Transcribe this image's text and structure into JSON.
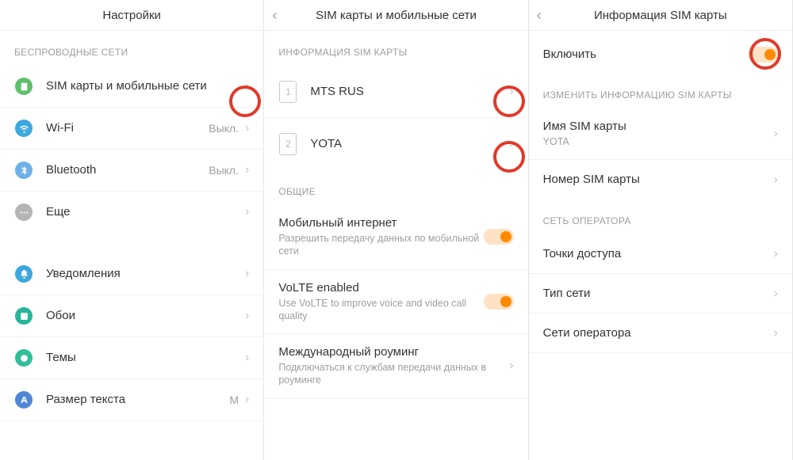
{
  "panel1": {
    "title": "Настройки",
    "section_wireless": "БЕСПРОВОДНЫЕ СЕТИ",
    "items": {
      "sim": {
        "label": "SIM карты и мобильные сети"
      },
      "wifi": {
        "label": "Wi-Fi",
        "status": "Выкл."
      },
      "bluetooth": {
        "label": "Bluetooth",
        "status": "Выкл."
      },
      "more": {
        "label": "Еще"
      },
      "notifications": {
        "label": "Уведомления"
      },
      "wallpaper": {
        "label": "Обои"
      },
      "themes": {
        "label": "Темы"
      },
      "textsize": {
        "label": "Размер текста",
        "status": "М"
      }
    }
  },
  "panel2": {
    "title": "SIM карты и мобильные сети",
    "section_siminfo": "ИНФОРМАЦИЯ SIM КАРТЫ",
    "sim1": {
      "slot": "1",
      "label": "MTS RUS"
    },
    "sim2": {
      "slot": "2",
      "label": "YOTA"
    },
    "section_general": "ОБЩИЕ",
    "mobile_data": {
      "label": "Мобильный интернет",
      "sub": "Разрешить передачу данных по мобильной сети"
    },
    "volte": {
      "label": "VoLTE enabled",
      "sub": "Use VoLTE to improve voice and video call quality"
    },
    "roaming": {
      "label": "Международный роуминг",
      "sub": "Подключаться к службам передачи данных в роуминге"
    }
  },
  "panel3": {
    "title": "Информация SIM карты",
    "enable": "Включить",
    "section_edit": "ИЗМЕНИТЬ ИНФОРМАЦИЮ SIM КАРТЫ",
    "sim_name": {
      "label": "Имя SIM карты",
      "value": "YOTA"
    },
    "sim_number": {
      "label": "Номер SIM карты"
    },
    "section_operator": "СЕТЬ ОПЕРАТОРА",
    "apn": "Точки доступа",
    "nettype": "Тип сети",
    "operators": "Сети оператора"
  }
}
